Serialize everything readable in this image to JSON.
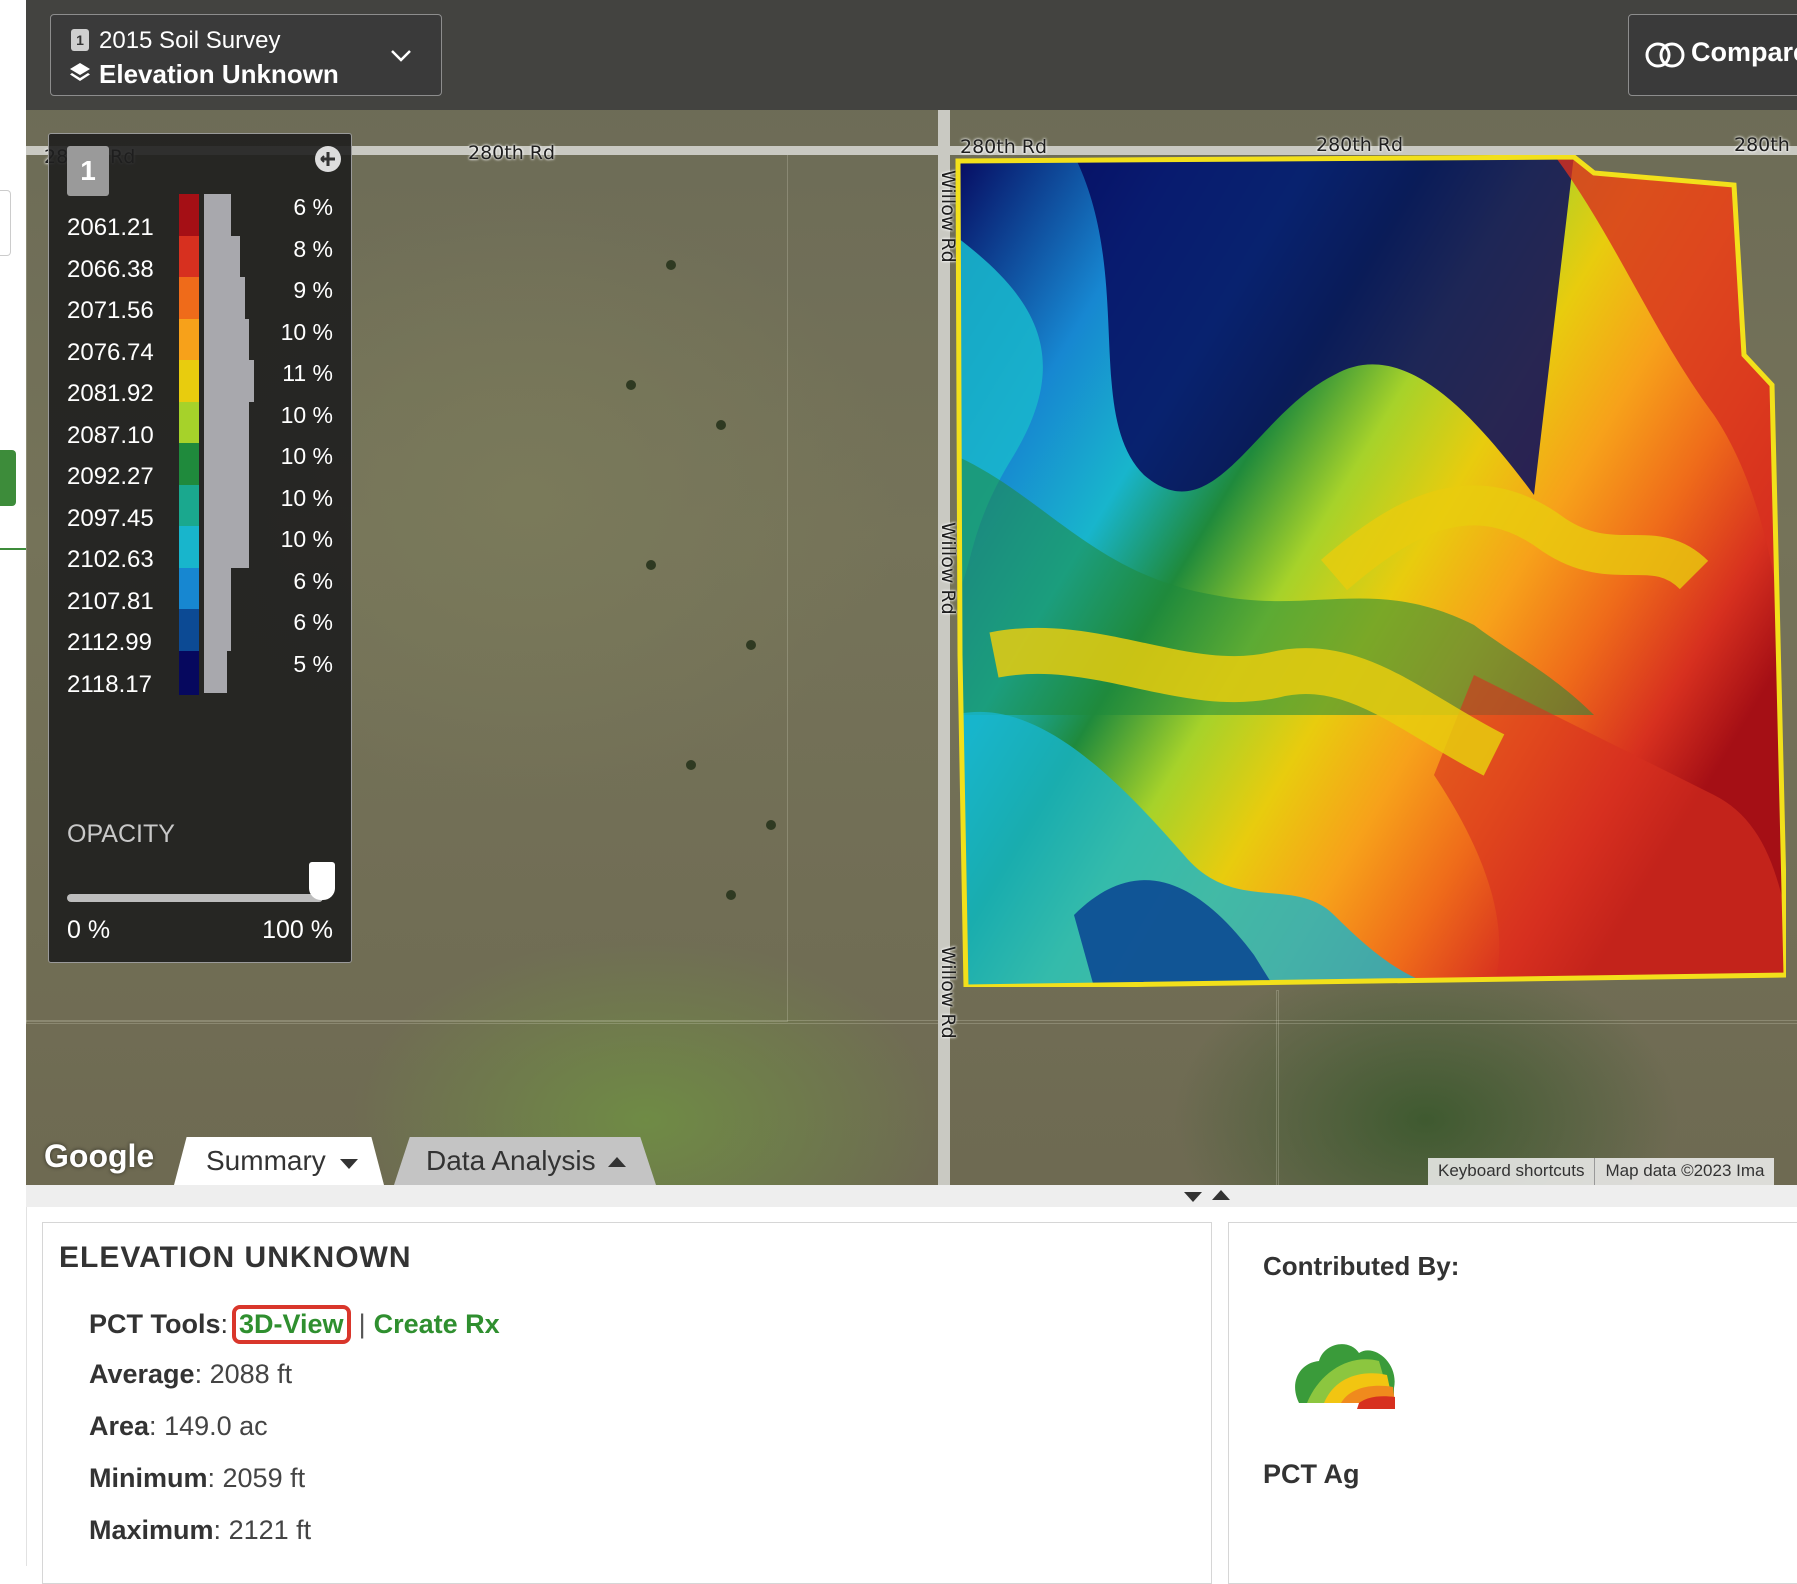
{
  "layer_selector": {
    "badge": "1",
    "survey": "2015 Soil Survey",
    "layer": "Elevation Unknown"
  },
  "compare": {
    "label": "Compare"
  },
  "roads": {
    "h_left": "280th Rd",
    "h_mid": "280th Rd",
    "h_right": "280th Rd",
    "h_far": "280th",
    "h_partial": "28",
    "h_partial_suffix": "Rd",
    "v_top": "Willow Rd",
    "v_mid": "Willow Rd",
    "v_bottom": "Willow Rd"
  },
  "legend": {
    "badge": "1",
    "rows": [
      {
        "value": "2061.21",
        "pct": "6 %",
        "color": "#a50f15",
        "share": 6
      },
      {
        "value": "2066.38",
        "pct": "8 %",
        "color": "#d7301f",
        "share": 8
      },
      {
        "value": "2071.56",
        "pct": "9 %",
        "color": "#ef6b1a",
        "share": 9
      },
      {
        "value": "2076.74",
        "pct": "10 %",
        "color": "#f7a11a",
        "share": 10
      },
      {
        "value": "2081.92",
        "pct": "11 %",
        "color": "#e8cc0e",
        "share": 11
      },
      {
        "value": "2087.10",
        "pct": "10 %",
        "color": "#a6d22a",
        "share": 10
      },
      {
        "value": "2092.27",
        "pct": "10 %",
        "color": "#1f8a3c",
        "share": 10
      },
      {
        "value": "2097.45",
        "pct": "10 %",
        "color": "#1aa88e",
        "share": 10
      },
      {
        "value": "2102.63",
        "pct": "10 %",
        "color": "#18b5cc",
        "share": 10
      },
      {
        "value": "2107.81",
        "pct": "6 %",
        "color": "#1787d1",
        "share": 6
      },
      {
        "value": "2112.99",
        "pct": "6 %",
        "color": "#0c4a94",
        "share": 6
      },
      {
        "value": "2118.17",
        "pct": "5 %",
        "color": "#06085e",
        "share": 5
      }
    ],
    "opacity_label": "OPACITY",
    "opacity_value": 1.0,
    "opacity_min": "0 %",
    "opacity_max": "100 %"
  },
  "map_footer": {
    "google": "Google",
    "tab_summary": "Summary",
    "tab_analysis": "Data Analysis",
    "shortcuts": "Keyboard shortcuts",
    "map_data": "Map data ©2023 Ima"
  },
  "summary": {
    "title": "ELEVATION UNKNOWN",
    "tools_label": "PCT Tools",
    "tool_3d": "3D-View",
    "tool_rx": "Create Rx",
    "stats": [
      {
        "label": "Average",
        "value": "2088 ft"
      },
      {
        "label": "Area",
        "value": "149.0 ac"
      },
      {
        "label": "Minimum",
        "value": "2059 ft"
      },
      {
        "label": "Maximum",
        "value": "2121 ft"
      }
    ]
  },
  "contributor": {
    "title": "Contributed By:",
    "name": "PCT Ag"
  },
  "colors": {
    "accent_green": "#2f8f2f",
    "highlight_red": "#d9362b",
    "field_border": "#f2e01b"
  }
}
